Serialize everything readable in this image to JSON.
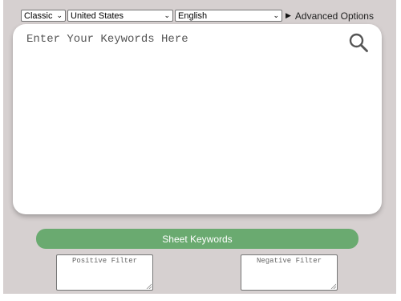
{
  "toolbar": {
    "mode": {
      "selected": "Classic",
      "icon": "chevron-down-icon"
    },
    "country": {
      "selected": "United States",
      "icon": "chevron-down-icon"
    },
    "language": {
      "selected": "English",
      "icon": "chevron-down-icon"
    },
    "advanced_options": {
      "label": "Advanced Options",
      "icon": "triangle-right-icon"
    }
  },
  "keyword_input": {
    "placeholder": "Enter Your Keywords Here",
    "search_icon": "search-icon"
  },
  "sheet_button": {
    "label": "Sheet Keywords",
    "color": "#6aaa70"
  },
  "filters": {
    "positive": {
      "placeholder": "Positive Filter"
    },
    "negative": {
      "placeholder": "Negative Filter"
    }
  },
  "colors": {
    "background": "#d6d0d0",
    "panel": "#ffffff",
    "accent": "#6aaa70"
  }
}
